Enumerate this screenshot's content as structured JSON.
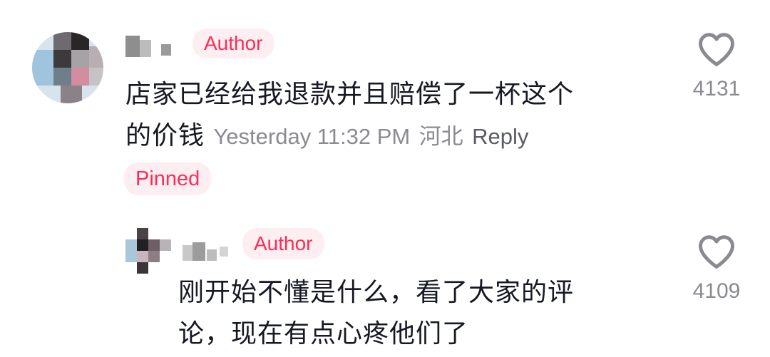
{
  "comments": [
    {
      "badge": "Author",
      "text_line1": "店家已经给我退款并且赔偿了一杯这个",
      "text_line2": "的价钱",
      "timestamp": "Yesterday 11:32 PM",
      "location": "河北",
      "reply_label": "Reply",
      "pinned_label": "Pinned",
      "like_count": "4131"
    },
    {
      "badge": "Author",
      "text_line1": "刚开始不懂是什么，看了大家的评",
      "text_line2": "论，现在有点心疼他们了",
      "like_count": "4109"
    }
  ],
  "colors": {
    "accent": "#fe2c55",
    "badge_bg": "#fdeff1",
    "meta_gray": "#8a8b91"
  },
  "icons": [
    "heart-outline-icon"
  ]
}
